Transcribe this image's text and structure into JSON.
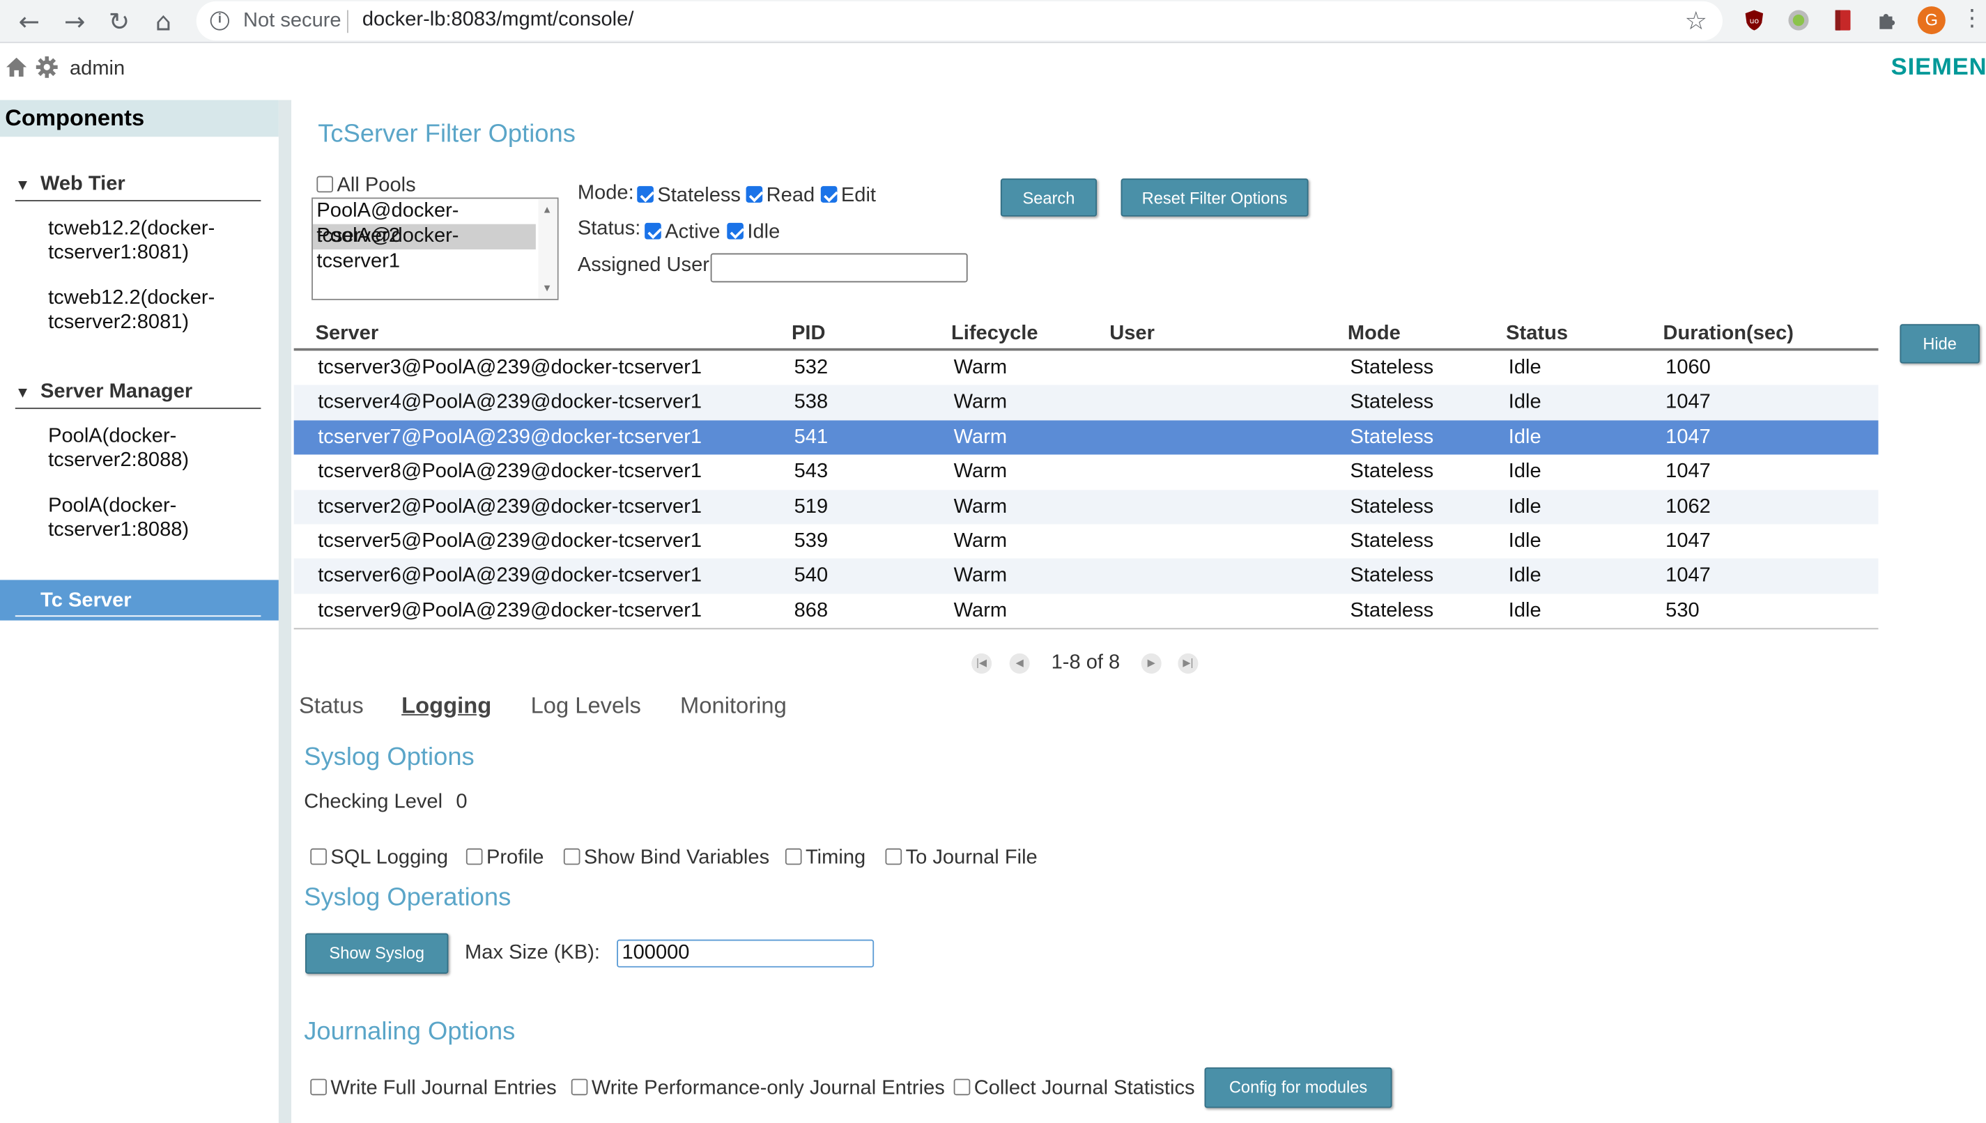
{
  "browser": {
    "security": "Not secure",
    "url": "docker-lb:8083/mgmt/console/",
    "profile_initial": "G"
  },
  "header": {
    "user": "admin",
    "brand": "SIEMEN",
    "brand_color": "#009999"
  },
  "sidebar": {
    "title": "Components",
    "sections": [
      {
        "label": "Web Tier",
        "items": [
          [
            "tcweb12.2(docker-",
            "tcserver1:8081)"
          ],
          [
            "tcweb12.2(docker-",
            "tcserver2:8081)"
          ]
        ]
      },
      {
        "label": "Server Manager",
        "items": [
          [
            "PoolA(docker-",
            "tcserver2:8088)"
          ],
          [
            "PoolA(docker-",
            "tcserver1:8088)"
          ]
        ]
      }
    ],
    "active": "Tc Server"
  },
  "filter": {
    "title": "TcServer Filter Options",
    "all_pools_label": "All Pools",
    "all_pools_checked": false,
    "pools": [
      "PoolA@docker-tcserver2",
      "PoolA@docker-tcserver1"
    ],
    "selected_pool": "PoolA@docker-tcserver1",
    "mode_label": "Mode:",
    "modes": [
      {
        "label": "Stateless",
        "checked": true
      },
      {
        "label": "Read",
        "checked": true
      },
      {
        "label": "Edit",
        "checked": true
      }
    ],
    "status_label": "Status:",
    "statuses": [
      {
        "label": "Active",
        "checked": true
      },
      {
        "label": "Idle",
        "checked": true
      }
    ],
    "assigned_user_label": "Assigned User:",
    "assigned_user_value": "",
    "search_button": "Search",
    "reset_button": "Reset Filter Options"
  },
  "table": {
    "columns": [
      "Server",
      "PID",
      "Lifecycle",
      "User",
      "Mode",
      "Status",
      "Duration(sec)"
    ],
    "rows": [
      [
        "tcserver3@PoolA@239@docker-tcserver1",
        "532",
        "Warm",
        "",
        "Stateless",
        "Idle",
        "1060"
      ],
      [
        "tcserver4@PoolA@239@docker-tcserver1",
        "538",
        "Warm",
        "",
        "Stateless",
        "Idle",
        "1047"
      ],
      [
        "tcserver7@PoolA@239@docker-tcserver1",
        "541",
        "Warm",
        "",
        "Stateless",
        "Idle",
        "1047"
      ],
      [
        "tcserver8@PoolA@239@docker-tcserver1",
        "543",
        "Warm",
        "",
        "Stateless",
        "Idle",
        "1047"
      ],
      [
        "tcserver2@PoolA@239@docker-tcserver1",
        "519",
        "Warm",
        "",
        "Stateless",
        "Idle",
        "1062"
      ],
      [
        "tcserver5@PoolA@239@docker-tcserver1",
        "539",
        "Warm",
        "",
        "Stateless",
        "Idle",
        "1047"
      ],
      [
        "tcserver6@PoolA@239@docker-tcserver1",
        "540",
        "Warm",
        "",
        "Stateless",
        "Idle",
        "1047"
      ],
      [
        "tcserver9@PoolA@239@docker-tcserver1",
        "868",
        "Warm",
        "",
        "Stateless",
        "Idle",
        "530"
      ]
    ],
    "selected_row": 2,
    "hide_button": "Hide",
    "pagination": "1-8 of 8"
  },
  "tabs": {
    "items": [
      "Status",
      "Logging",
      "Log Levels",
      "Monitoring"
    ],
    "active": "Logging"
  },
  "syslog": {
    "title": "Syslog Options",
    "checking_level_label": "Checking Level",
    "checking_level_value": "0",
    "options": [
      {
        "label": "SQL Logging",
        "checked": false
      },
      {
        "label": "Profile",
        "checked": false
      },
      {
        "label": "Show Bind Variables",
        "checked": false
      },
      {
        "label": "Timing",
        "checked": false
      },
      {
        "label": "To Journal File",
        "checked": false
      }
    ]
  },
  "syslog_ops": {
    "title": "Syslog Operations",
    "show_button": "Show Syslog",
    "max_size_label": "Max Size (KB):",
    "max_size_value": "100000"
  },
  "journaling": {
    "title": "Journaling Options",
    "options": [
      {
        "label": "Write Full Journal Entries",
        "checked": false
      },
      {
        "label": "Write Performance-only Journal Entries",
        "checked": false
      },
      {
        "label": "Collect Journal Statistics",
        "checked": false
      }
    ],
    "config_button": "Config for modules"
  }
}
